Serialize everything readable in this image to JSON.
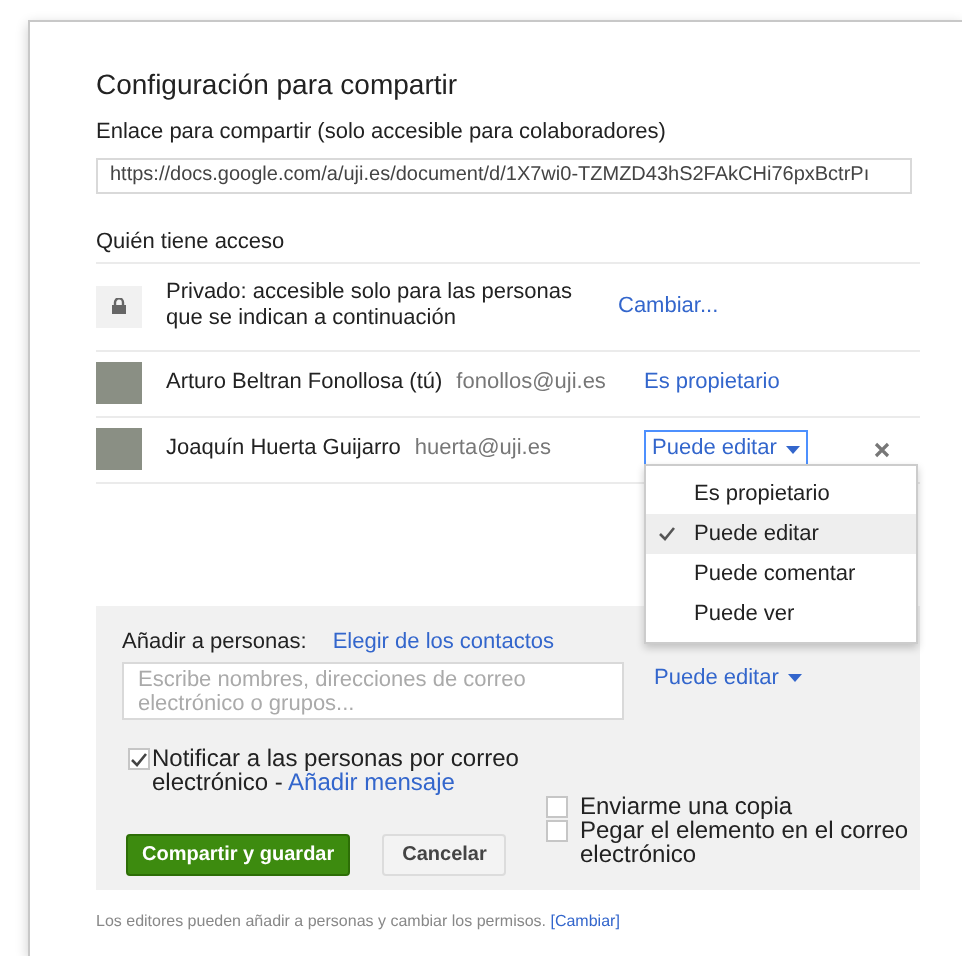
{
  "title": "Configuración para compartir",
  "link": {
    "label": "Enlace para compartir (solo accesible para colaboradores)",
    "value": "https://docs.google.com/a/uji.es/document/d/1X7wi0-TZMZD43hS2FAkCHi76pxBctrPı"
  },
  "access": {
    "heading": "Quién tiene acceso",
    "privacy": {
      "text": "Privado: accesible solo para las personas que se indican a continuación",
      "action": "Cambiar..."
    },
    "people": [
      {
        "name": "Arturo Beltran Fonollosa (tú)",
        "email": "fonollos@uji.es",
        "role": "Es propietario",
        "kind": "owner"
      },
      {
        "name": "Joaquín Huerta Guijarro",
        "email": "huerta@uji.es",
        "role": "Puede editar",
        "kind": "editable"
      }
    ]
  },
  "role_menu": {
    "items": [
      {
        "label": "Es propietario",
        "selected": false
      },
      {
        "label": "Puede editar",
        "selected": true
      },
      {
        "label": "Puede comentar",
        "selected": false
      },
      {
        "label": "Puede ver",
        "selected": false
      }
    ]
  },
  "add": {
    "label": "Añadir a personas:",
    "link": "Elegir de los contactos",
    "placeholder": "Escribe nombres, direcciones de correo electrónico o grupos...",
    "role": "Puede editar",
    "notify": {
      "checked": true,
      "text": "Notificar a las personas por correo electrónico - ",
      "link": "Añadir mensaje"
    },
    "options": [
      {
        "text": "Enviarme una copia",
        "checked": false
      },
      {
        "text": "Pegar el elemento en el correo electrónico",
        "checked": false
      }
    ],
    "buttons": [
      {
        "label": "Compartir y guardar",
        "kind": "primary"
      },
      {
        "label": "Cancelar",
        "kind": "secondary"
      }
    ]
  },
  "footer": {
    "text": "Los editores pueden añadir a personas y cambiar los permisos.",
    "link": "[Cambiar]"
  }
}
